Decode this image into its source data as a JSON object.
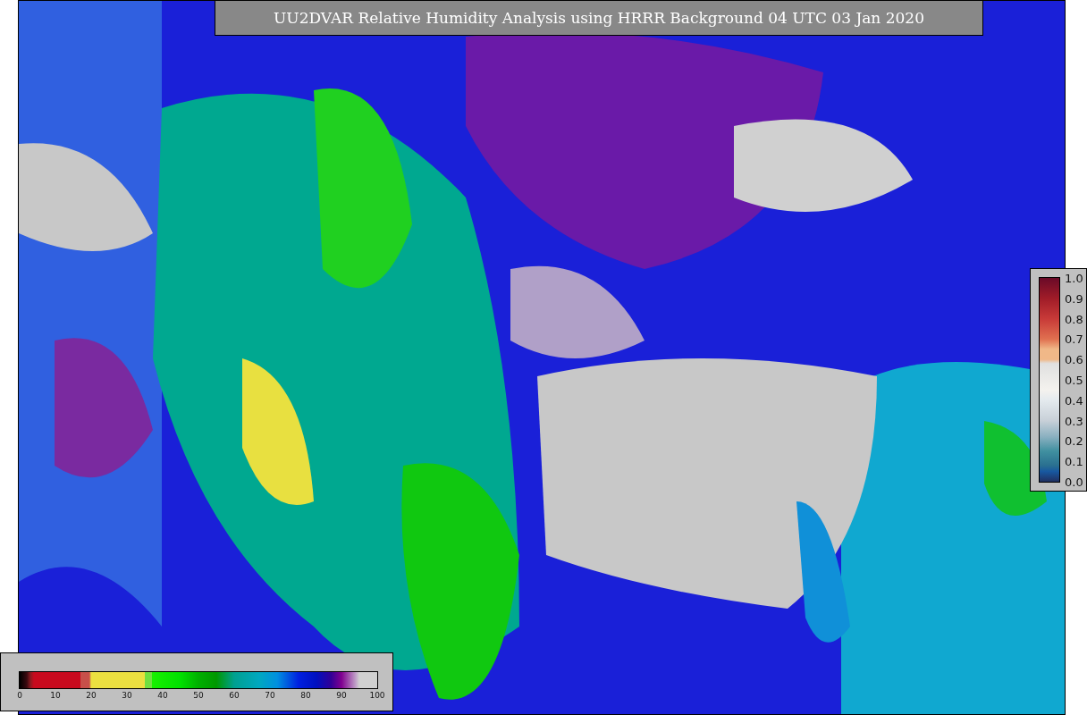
{
  "title": "UU2DVAR Relative Humidity Analysis using HRRR Background 04 UTC 03 Jan 2020",
  "humidity_colorbar": {
    "ticks": [
      "0",
      "10",
      "20",
      "30",
      "40",
      "50",
      "60",
      "70",
      "80",
      "90",
      "100"
    ]
  },
  "observation_colorbar": {
    "ticks": [
      "1.0",
      "0.9",
      "0.8",
      "0.7",
      "0.6",
      "0.5",
      "0.4",
      "0.3",
      "0.2",
      "0.1",
      "0.0"
    ]
  }
}
